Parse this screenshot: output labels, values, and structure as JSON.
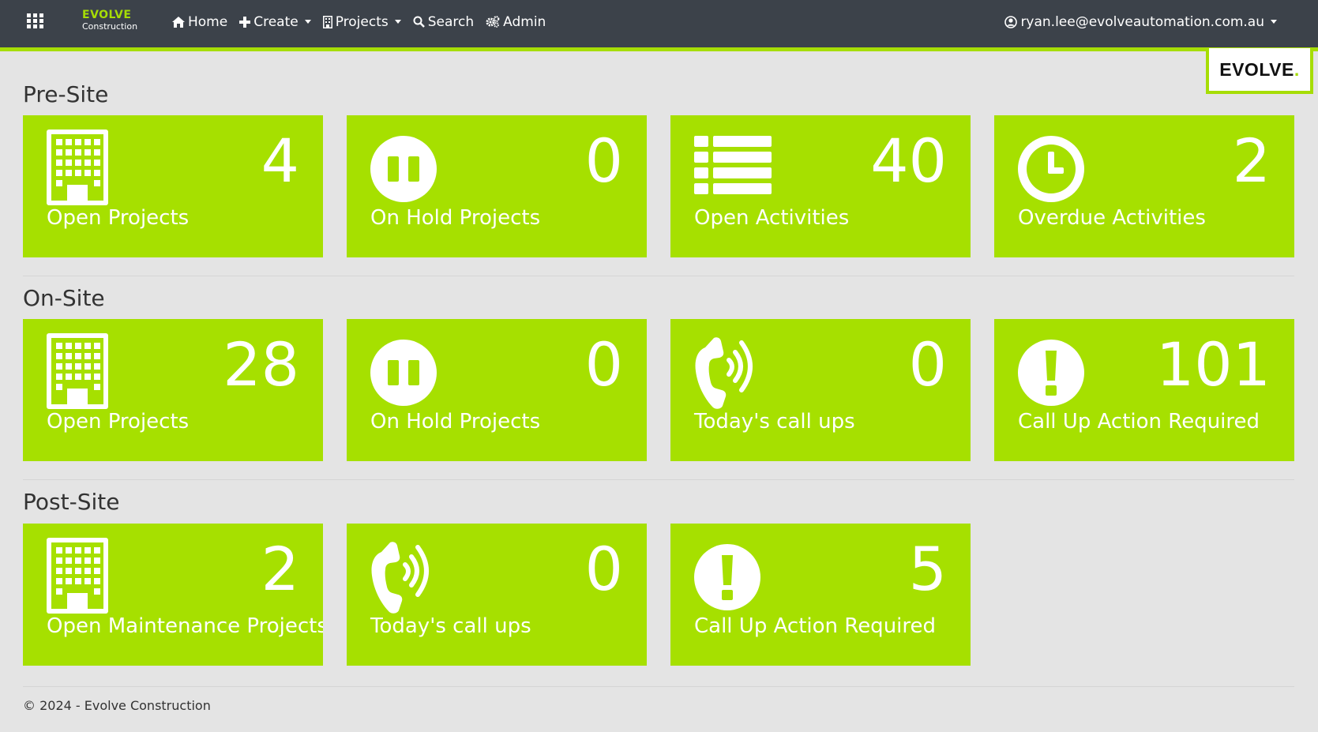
{
  "brand": {
    "name": "EVOLVE",
    "sub": "Construction",
    "logo": "EVOLVE",
    "accent": "#a6dd05"
  },
  "nav": {
    "items": [
      {
        "label": "Home",
        "icon": "home-icon"
      },
      {
        "label": "Create",
        "icon": "plus-icon"
      },
      {
        "label": "Projects",
        "icon": "building-icon"
      },
      {
        "label": "Search",
        "icon": "search-icon"
      },
      {
        "label": "Admin",
        "icon": "cogs-icon"
      }
    ],
    "user": "ryan.lee@evolveautomation.com.au"
  },
  "sections": [
    {
      "title": "Pre-Site",
      "tiles": [
        {
          "value": "4",
          "label": "Open Projects",
          "icon": "building-icon"
        },
        {
          "value": "0",
          "label": "On Hold Projects",
          "icon": "pause-icon"
        },
        {
          "value": "40",
          "label": "Open Activities",
          "icon": "list-icon"
        },
        {
          "value": "2",
          "label": "Overdue Activities",
          "icon": "clock-icon"
        }
      ]
    },
    {
      "title": "On-Site",
      "tiles": [
        {
          "value": "28",
          "label": "Open Projects",
          "icon": "building-icon"
        },
        {
          "value": "0",
          "label": "On Hold Projects",
          "icon": "pause-icon"
        },
        {
          "value": "0",
          "label": "Today's call ups",
          "icon": "phone-volume-icon"
        },
        {
          "value": "101",
          "label": "Call Up Action Required",
          "icon": "exclamation-icon"
        }
      ]
    },
    {
      "title": "Post-Site",
      "tiles": [
        {
          "value": "2",
          "label": "Open Maintenance Projects",
          "icon": "building-icon"
        },
        {
          "value": "0",
          "label": "Today's call ups",
          "icon": "phone-volume-icon"
        },
        {
          "value": "5",
          "label": "Call Up Action Required",
          "icon": "exclamation-icon"
        }
      ]
    }
  ],
  "footer": "© 2024 - Evolve Construction",
  "colors": {
    "navbar": "#3c424a",
    "tile": "#a6e000",
    "background": "#e4e4e4"
  }
}
